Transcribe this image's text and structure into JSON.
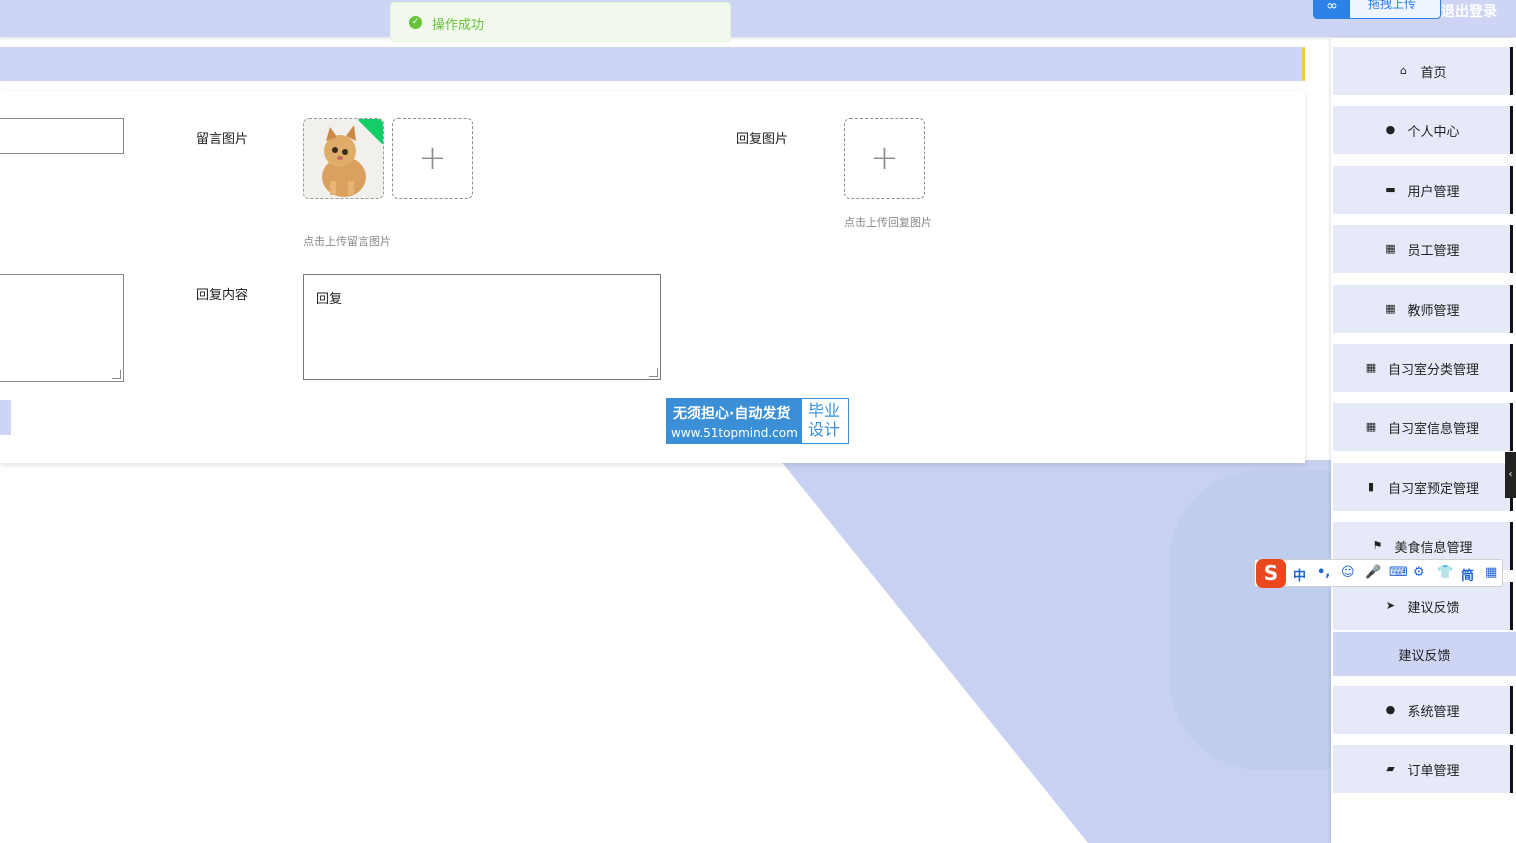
{
  "topbar": {
    "upload_label": "拖拽上传",
    "logout_label": "退出登录"
  },
  "toast": {
    "message": "操作成功"
  },
  "form": {
    "message_image_label": "留言图片",
    "message_image_hint": "点击上传留言图片",
    "reply_image_label": "回复图片",
    "reply_image_hint": "点击上传回复图片",
    "reply_content_label": "回复内容",
    "reply_content_value": "回复",
    "upload_plus": "+"
  },
  "watermark": {
    "line1": "无须担心·自动发货",
    "line2": "www.51topmind.com",
    "right_top": "毕业",
    "right_bottom": "设计"
  },
  "sidebar": {
    "items": [
      {
        "label": "首页",
        "icon": "home-icon"
      },
      {
        "label": "个人中心",
        "icon": "user-icon"
      },
      {
        "label": "用户管理",
        "icon": "monitor-icon"
      },
      {
        "label": "员工管理",
        "icon": "grid-icon"
      },
      {
        "label": "教师管理",
        "icon": "grid-icon"
      },
      {
        "label": "自习室分类管理",
        "icon": "grid-icon"
      },
      {
        "label": "自习室信息管理",
        "icon": "grid-icon"
      },
      {
        "label": "自习室预定管理",
        "icon": "book-icon"
      },
      {
        "label": "美食信息管理",
        "icon": "flag-icon"
      },
      {
        "label": "建议反馈",
        "icon": "send-icon"
      },
      {
        "label": "系统管理",
        "icon": "bulb-icon"
      },
      {
        "label": "订单管理",
        "icon": "wallet-icon"
      }
    ],
    "sub_item": "建议反馈"
  },
  "ime": {
    "items": [
      "中",
      "•,",
      "☺",
      "🎤",
      "⌨",
      "⚙",
      "👕",
      "简",
      "▦"
    ]
  }
}
